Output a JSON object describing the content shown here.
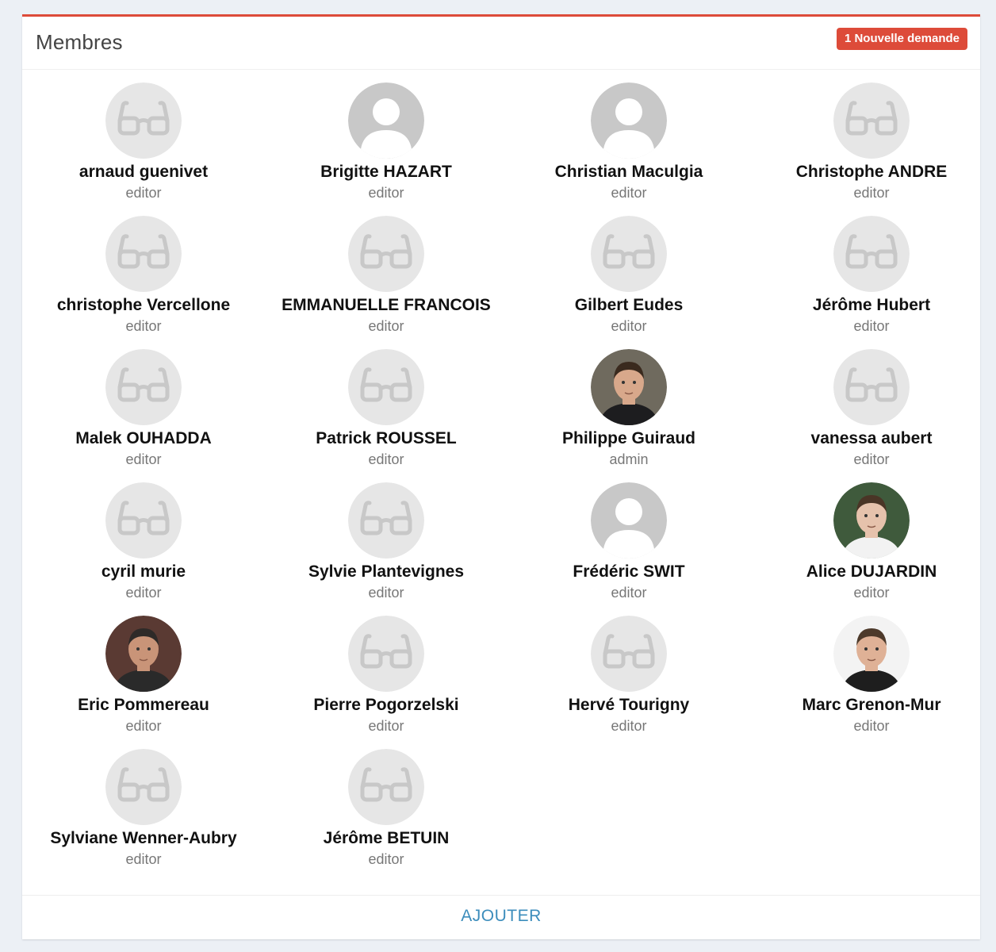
{
  "panel": {
    "title": "Membres",
    "badge": "1 Nouvelle demande",
    "add_label": "AJOUTER"
  },
  "colors": {
    "accent": "#dd4b39",
    "link": "#3c8dbc",
    "avatar_bg": "#e6e6e6",
    "avatar_glyph": "#c8c8c8"
  },
  "members": [
    {
      "name": "arnaud guenivet",
      "role": "editor",
      "avatar": "glasses-icon"
    },
    {
      "name": "Brigitte HAZART",
      "role": "editor",
      "avatar": "person-silhouette-icon"
    },
    {
      "name": "Christian Maculgia",
      "role": "editor",
      "avatar": "person-silhouette-icon"
    },
    {
      "name": "Christophe ANDRE",
      "role": "editor",
      "avatar": "glasses-icon"
    },
    {
      "name": "christophe Vercellone",
      "role": "editor",
      "avatar": "glasses-icon"
    },
    {
      "name": "EMMANUELLE FRANCOIS",
      "role": "editor",
      "avatar": "glasses-icon"
    },
    {
      "name": "Gilbert Eudes",
      "role": "editor",
      "avatar": "glasses-icon"
    },
    {
      "name": "Jérôme Hubert",
      "role": "editor",
      "avatar": "glasses-icon"
    },
    {
      "name": "Malek OUHADDA",
      "role": "editor",
      "avatar": "glasses-icon"
    },
    {
      "name": "Patrick ROUSSEL",
      "role": "editor",
      "avatar": "glasses-icon"
    },
    {
      "name": "Philippe Guiraud",
      "role": "admin",
      "avatar": "photo"
    },
    {
      "name": "vanessa aubert",
      "role": "editor",
      "avatar": "glasses-icon"
    },
    {
      "name": "cyril murie",
      "role": "editor",
      "avatar": "glasses-icon"
    },
    {
      "name": "Sylvie Plantevignes",
      "role": "editor",
      "avatar": "glasses-icon"
    },
    {
      "name": "Frédéric SWIT",
      "role": "editor",
      "avatar": "person-silhouette-icon"
    },
    {
      "name": "Alice DUJARDIN",
      "role": "editor",
      "avatar": "photo"
    },
    {
      "name": "Eric Pommereau",
      "role": "editor",
      "avatar": "photo"
    },
    {
      "name": "Pierre Pogorzelski",
      "role": "editor",
      "avatar": "glasses-icon"
    },
    {
      "name": "Hervé Tourigny",
      "role": "editor",
      "avatar": "glasses-icon"
    },
    {
      "name": "Marc Grenon-Mur",
      "role": "editor",
      "avatar": "photo"
    },
    {
      "name": "Sylviane Wenner-Aubry",
      "role": "editor",
      "avatar": "glasses-icon"
    },
    {
      "name": "Jérôme BETUIN",
      "role": "editor",
      "avatar": "glasses-icon"
    }
  ]
}
